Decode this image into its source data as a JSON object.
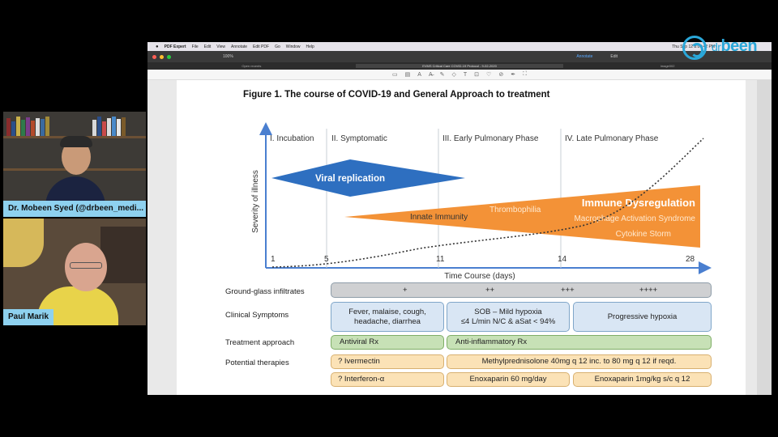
{
  "logo": {
    "prefix": "dr",
    "word": "been",
    "color": "#2aa7d9"
  },
  "participants": [
    {
      "name": "Dr. Mobeen Syed (@drbeen_medi..."
    },
    {
      "name": "Paul Marik"
    }
  ],
  "mac_menu": {
    "apple": "",
    "items": [
      "PDF Expert",
      "File",
      "Edit",
      "View",
      "Annotate",
      "Edit PDF",
      "Go",
      "Window",
      "Help"
    ],
    "clock": "Thu Sep 12  8:00:42 PM"
  },
  "pdf_app": {
    "zoom": "100%",
    "modes": [
      "Annotate",
      "Edit"
    ],
    "tabs": [
      "Open recents",
      "EVMS Critical Care COVID-19 Protocol - 9-02-2020",
      "image002"
    ],
    "tool_icons": [
      "select-icon",
      "highlight-icon",
      "text-icon",
      "strike-icon",
      "pen-icon",
      "shape-icon",
      "textbox-icon",
      "stamp-icon",
      "comment-icon",
      "link-icon",
      "signature-icon",
      "expand-icon"
    ]
  },
  "figure": {
    "title": "Figure 1.  The course of COVID-19 and General Approach to treatment",
    "phases": [
      "I. Incubation",
      "II. Symptomatic",
      "III. Early Pulmonary Phase",
      "IV. Late Pulmonary Phase"
    ],
    "y_axis": "Severity of illness",
    "x_axis": "Time Course (days)",
    "x_ticks": [
      "1",
      "5",
      "11",
      "14",
      "28"
    ],
    "viral": "Viral replication",
    "immune_title": "Immune Dysregulation",
    "innate": "Innate Immunity",
    "thrombophilia": "Thrombophilia",
    "macrophage": "Macrophage Activation Syndrome",
    "cytokine": "Cytokine Storm",
    "colors": {
      "blue": "#2e6fc0",
      "orange": "#f39237",
      "axis": "#4a7fd0"
    }
  },
  "table": {
    "labels": [
      "Ground-glass infiltrates",
      "Clinical Symptoms",
      "Treatment approach",
      "Potential therapies"
    ],
    "ggo": [
      "+",
      "++",
      "+++",
      "++++"
    ],
    "symptoms": [
      "Fever, malaise, cough,\nheadache, diarrhea",
      "SOB – Mild hypoxia\n≤4 L/min N/C & aSat < 94%",
      "Progressive hypoxia"
    ],
    "treatment": [
      "Antiviral Rx",
      "Anti-inflammatory Rx"
    ],
    "therapies_row1": [
      "? Ivermectin",
      "Methylprednisolone 40mg q 12 inc. to 80 mg q 12 if reqd."
    ],
    "therapies_row2": [
      "? Interferon-α",
      "Enoxaparin 60 mg/day",
      "Enoxaparin 1mg/kg s/c q 12"
    ]
  }
}
